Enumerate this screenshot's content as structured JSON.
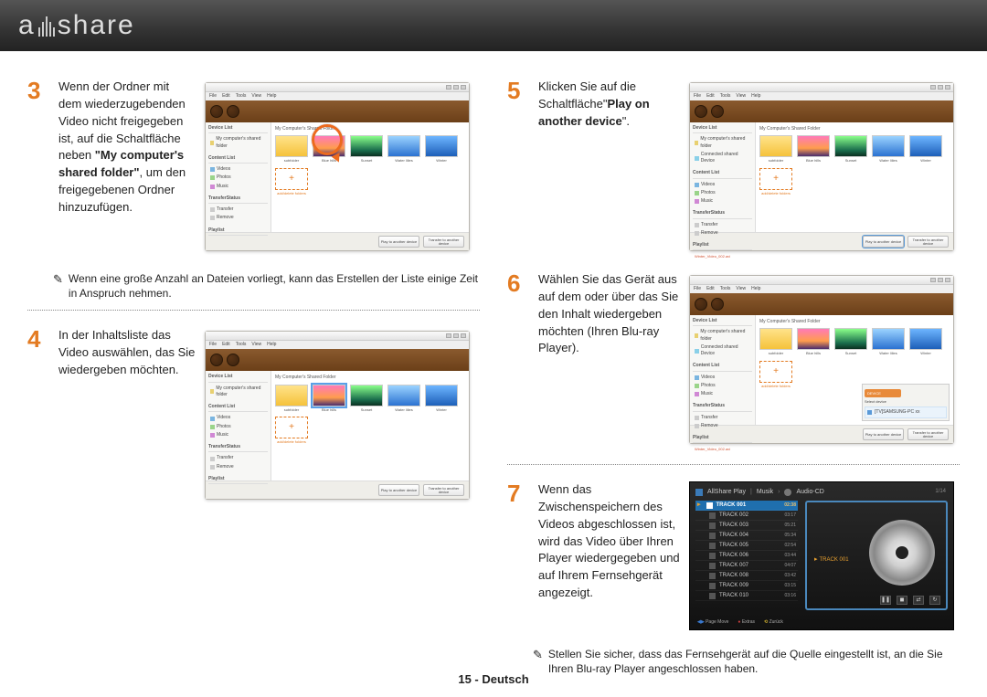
{
  "header": {
    "logo_left": "a",
    "logo_right": "share"
  },
  "steps": {
    "s3": {
      "num": "3",
      "text_a": "Wenn der Ordner mit dem wiederzugebenden Video nicht freigegeben ist, auf die Schaltfläche neben ",
      "text_bold": "\"My computer's shared folder\"",
      "text_b": ", um den freigegebenen Ordner hinzuzufügen."
    },
    "s3_note": "Wenn eine große Anzahl an Dateien vorliegt, kann das Erstellen der Liste einige Zeit in Anspruch nehmen.",
    "s4": {
      "num": "4",
      "text": "In der Inhaltsliste das Video auswählen, das Sie wiedergeben möchten."
    },
    "s5": {
      "num": "5",
      "text_a": "Klicken Sie auf die Schaltfläche\"",
      "text_bold": "Play on another device",
      "text_b": "\"."
    },
    "s6": {
      "num": "6",
      "text": "Wählen Sie das Gerät aus auf dem oder über das Sie den Inhalt wiedergeben möchten (Ihren Blu-ray Player)."
    },
    "s7": {
      "num": "7",
      "text": "Wenn das Zwischenspeichern des Videos abgeschlossen ist, wird das Video über Ihren Player wiedergegeben und auf Ihrem Fernsehgerät angezeigt."
    },
    "s7_note": "Stellen Sie sicher, dass das Fernsehgerät auf die Quelle eingestellt ist, an die Sie Ihren Blu-ray Player angeschlossen haben."
  },
  "app": {
    "menu": [
      "File",
      "Edit",
      "Tools",
      "View",
      "Help"
    ],
    "crumb": "My Computer's Shared Folder",
    "side": {
      "sec1": "Device List",
      "sec1_item": "My computer's shared folder",
      "sec2": "Content List",
      "items2": [
        "Videos",
        "Photos",
        "Music"
      ],
      "sec3": "TransferStatus",
      "items3": [
        "Transfer",
        "Remove"
      ],
      "sec4": "Playlist"
    },
    "thumbs": {
      "folder": "subfolder",
      "t1": "Blue hills",
      "t2": "Sunset",
      "t3": "Water lilies",
      "t4": "Winter",
      "add": "+",
      "add_lbl": "add/delete folders"
    },
    "footer": {
      "b1": "Play to another device",
      "b2": "Transfer to another device"
    },
    "device_popup": {
      "title": "DEVICE",
      "text1": "Select device",
      "item": "[TV]SAMSUNG-PC xx"
    },
    "side_extra": "Connected shared Device",
    "selected_item": "Winter_Video_002.avi"
  },
  "player": {
    "title": "AllShare Play",
    "crumb1": "Musik",
    "crumb2": "Audio-CD",
    "count": "1/14",
    "tracks": [
      {
        "n": "TRACK 001",
        "d": "02:38",
        "sel": true
      },
      {
        "n": "TRACK 002",
        "d": "03:17"
      },
      {
        "n": "TRACK 003",
        "d": "05:21"
      },
      {
        "n": "TRACK 004",
        "d": "05:34"
      },
      {
        "n": "TRACK 005",
        "d": "02:54"
      },
      {
        "n": "TRACK 006",
        "d": "03:44"
      },
      {
        "n": "TRACK 007",
        "d": "04:07"
      },
      {
        "n": "TRACK 008",
        "d": "03:42"
      },
      {
        "n": "TRACK 009",
        "d": "03:15"
      },
      {
        "n": "TRACK 010",
        "d": "03:16"
      }
    ],
    "nowplaying": "TRACK 001",
    "foot": {
      "a": "Page Move",
      "b": "Extras",
      "c": "Zurück"
    }
  },
  "footer": "15 - Deutsch",
  "note_icon": "✎"
}
